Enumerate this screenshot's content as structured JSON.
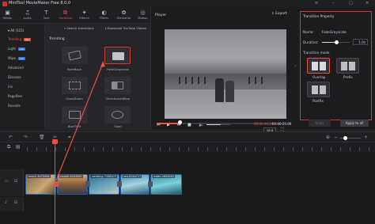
{
  "app": {
    "title": "MiniTool MovieMaker Free 8.0.0"
  },
  "toolbar": {
    "items": [
      {
        "label": "Media",
        "icon": "media-icon"
      },
      {
        "label": "Audio",
        "icon": "audio-icon"
      },
      {
        "label": "Text",
        "icon": "text-icon"
      },
      {
        "label": "Transition",
        "icon": "transition-icon"
      },
      {
        "label": "Effects",
        "icon": "effects-icon"
      },
      {
        "label": "Filters",
        "icon": "filters-icon"
      },
      {
        "label": "Elements",
        "icon": "elements-icon"
      },
      {
        "label": "Motion",
        "icon": "motion-icon"
      }
    ],
    "active": "Transition"
  },
  "categories": {
    "all": "All (115)",
    "items": [
      {
        "label": "Trending",
        "badge": "new"
      },
      {
        "label": "Light",
        "badge": "new"
      },
      {
        "label": "Wipe",
        "badge": "new"
      },
      {
        "label": "Advanced",
        "badge": ""
      },
      {
        "label": "Dissolve",
        "badge": ""
      },
      {
        "label": "Iris",
        "badge": ""
      },
      {
        "label": "PagePeel",
        "badge": ""
      },
      {
        "label": "Reveals",
        "badge": ""
      }
    ]
  },
  "grid": {
    "search_label": "Search transitions",
    "download_label": "Download YouTube Videos",
    "section": "Trending",
    "transitions": [
      "FadeBack",
      "FadeGrayscale",
      "CrossZoom",
      "DirectionalWipe",
      "BowTieV",
      "Swirl"
    ]
  },
  "player": {
    "title": "Player",
    "export_label": "Export",
    "time_current": "00:00:04.24",
    "time_total": "00:00:25.00",
    "aspect": "16:9",
    "progress": 0.18,
    "volume": 0.6
  },
  "property": {
    "title": "Transition Property",
    "name_label": "Name:",
    "name_value": "FadeGrayscale",
    "duration_label": "Duration:",
    "duration_value": "1.0s",
    "mode_label": "Transition mode",
    "modes": [
      "Overlap",
      "Prefix",
      "Postfix"
    ],
    "apply_label": "Apply",
    "apply_all_label": "Apply to all"
  },
  "timeline": {
    "clips": [
      "beach-6475464",
      "couple-4434580",
      "wedding-7336107",
      "sea-6344717",
      "water-2603060"
    ]
  },
  "colors": {
    "accent": "#e8523f",
    "highlight": "#d23a2d",
    "clip_border": "#2c5fa0"
  }
}
